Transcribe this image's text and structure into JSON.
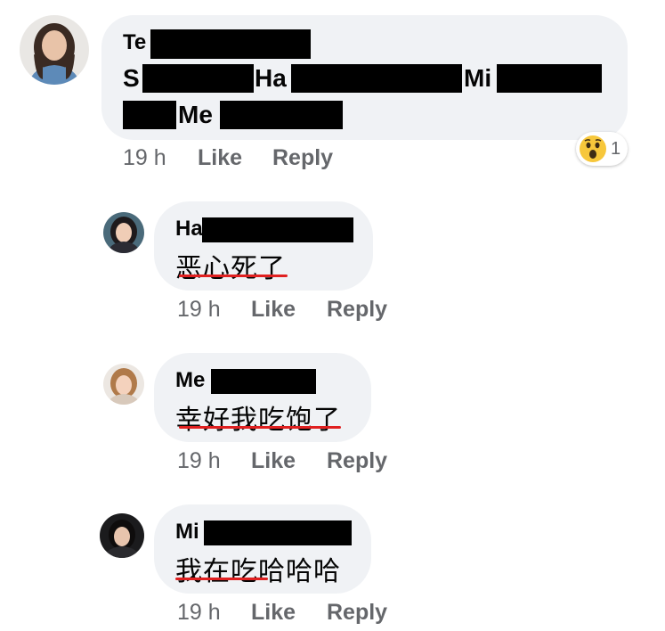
{
  "comments": [
    {
      "name": "Te",
      "line1": [
        "S",
        "Ha",
        "Mi"
      ],
      "line2": [
        "Me"
      ],
      "time": "19 h",
      "like": "Like",
      "reply": "Reply",
      "reaction": {
        "icon": "wow-emoji-icon",
        "count": "1"
      }
    },
    {
      "name": "Ha",
      "text": "恶心死了",
      "time": "19 h",
      "like": "Like",
      "reply": "Reply"
    },
    {
      "name": "Me",
      "text": "幸好我吃饱了",
      "time": "19 h",
      "like": "Like",
      "reply": "Reply"
    },
    {
      "name": "Mi",
      "text": "我在吃哈哈哈",
      "time": "19 h",
      "like": "Like",
      "reply": "Reply"
    }
  ],
  "colors": {
    "bubble": "#f0f2f5",
    "redaction": "#000000",
    "underline": "#e02020",
    "meta": "#65676b"
  }
}
